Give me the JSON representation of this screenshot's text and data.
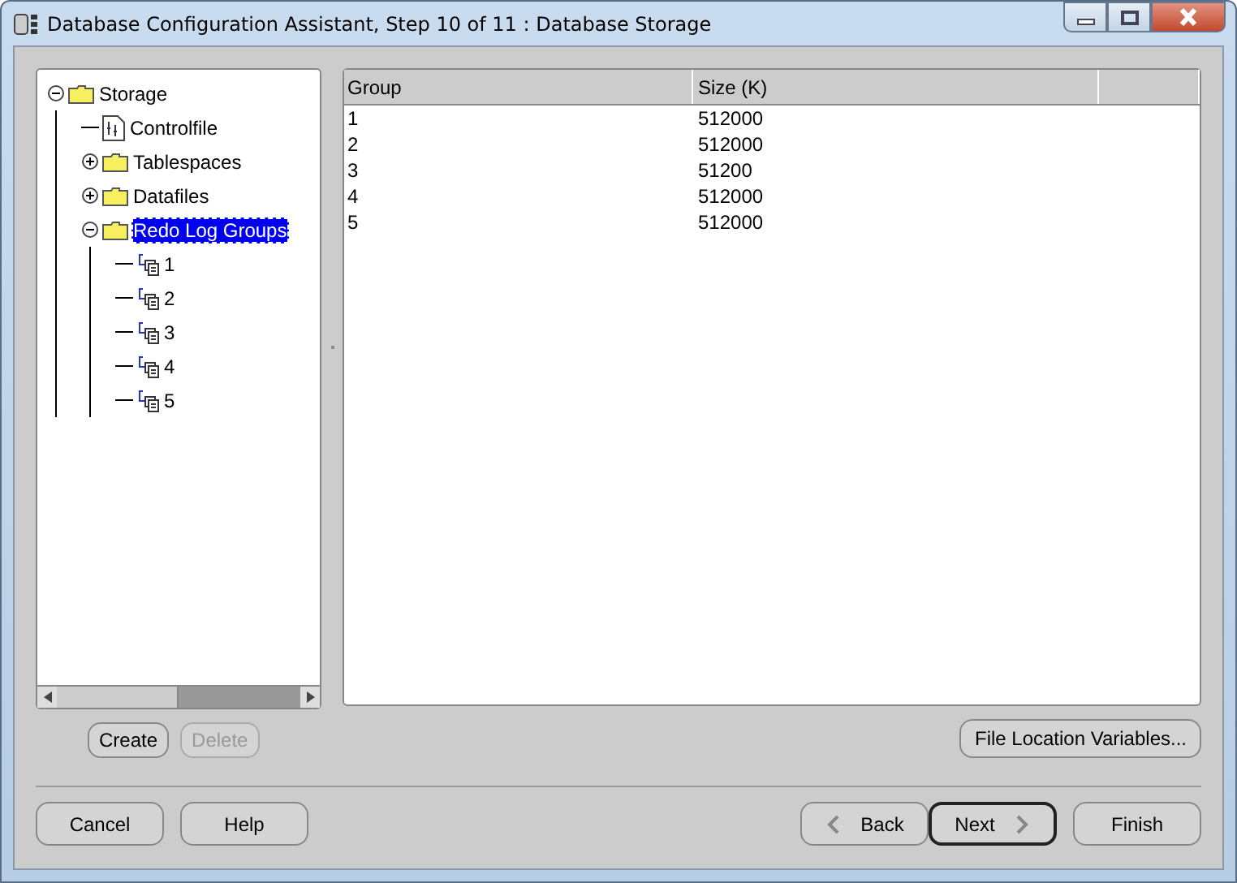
{
  "window": {
    "title": "Database Configuration Assistant, Step 10 of 11 : Database Storage"
  },
  "tree": [
    {
      "label": "Storage",
      "kind": "folder",
      "expanded": true,
      "selected": false,
      "children": [
        {
          "label": "Controlfile",
          "kind": "file",
          "selected": false
        },
        {
          "label": "Tablespaces",
          "kind": "folder",
          "expanded": false,
          "selected": false
        },
        {
          "label": "Datafiles",
          "kind": "folder",
          "expanded": false,
          "selected": false
        },
        {
          "label": "Redo Log Groups",
          "kind": "folder",
          "expanded": true,
          "selected": true,
          "children": [
            {
              "label": "1",
              "kind": "group",
              "selected": false
            },
            {
              "label": "2",
              "kind": "group",
              "selected": false
            },
            {
              "label": "3",
              "kind": "group",
              "selected": false
            },
            {
              "label": "4",
              "kind": "group",
              "selected": false
            },
            {
              "label": "5",
              "kind": "group",
              "selected": false
            }
          ]
        }
      ]
    }
  ],
  "tree_buttons": [
    {
      "label": "Create",
      "disabled": false
    },
    {
      "label": "Delete",
      "disabled": true
    }
  ],
  "table": {
    "columns": [
      "Group",
      "Size (K)"
    ],
    "rows": [
      [
        "1",
        "512000"
      ],
      [
        "2",
        "512000"
      ],
      [
        "3",
        "51200"
      ],
      [
        "4",
        "512000"
      ],
      [
        "5",
        "512000"
      ]
    ]
  },
  "file_location_button": "File Location Variables...",
  "footer_left": [
    "Cancel",
    "Help"
  ],
  "footer_right": [
    {
      "label": "Back",
      "kind": "back",
      "default": false
    },
    {
      "label": "Next",
      "kind": "next",
      "default": true
    },
    {
      "label": "Finish",
      "kind": "plain",
      "default": false
    }
  ]
}
